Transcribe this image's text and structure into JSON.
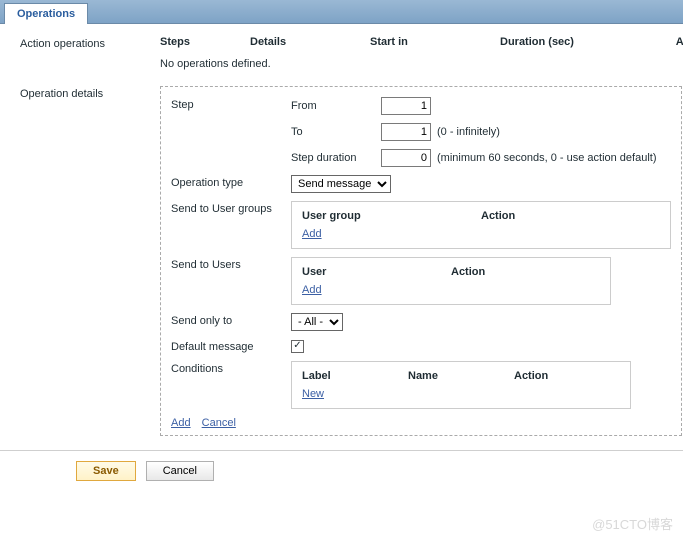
{
  "tab": {
    "label": "Operations"
  },
  "action_ops": {
    "section_label": "Action operations",
    "cols": {
      "steps": "Steps",
      "details": "Details",
      "start_in": "Start in",
      "duration": "Duration (sec)",
      "action": "Action"
    },
    "empty_text": "No operations defined."
  },
  "op_details": {
    "section_label": "Operation details",
    "step_label": "Step",
    "from_label": "From",
    "from_value": "1",
    "to_label": "To",
    "to_value": "1",
    "to_hint": "(0 - infinitely)",
    "step_duration_label": "Step duration",
    "step_duration_value": "0",
    "step_duration_hint": "(minimum 60 seconds, 0 - use action default)",
    "op_type_label": "Operation type",
    "op_type_value": "Send message",
    "send_groups_label": "Send to User groups",
    "groups_table": {
      "col1": "User group",
      "col2": "Action",
      "add": "Add"
    },
    "send_users_label": "Send to Users",
    "users_table": {
      "col1": "User",
      "col2": "Action",
      "add": "Add"
    },
    "send_only_label": "Send only to",
    "send_only_value": "- All -",
    "default_msg_label": "Default message",
    "default_msg_checked": "✓",
    "conditions_label": "Conditions",
    "conditions_table": {
      "col1": "Label",
      "col2": "Name",
      "col3": "Action",
      "new": "New"
    },
    "bottom": {
      "add": "Add",
      "cancel": "Cancel"
    }
  },
  "footer": {
    "save": "Save",
    "cancel": "Cancel"
  },
  "watermark": "@51CTO博客"
}
